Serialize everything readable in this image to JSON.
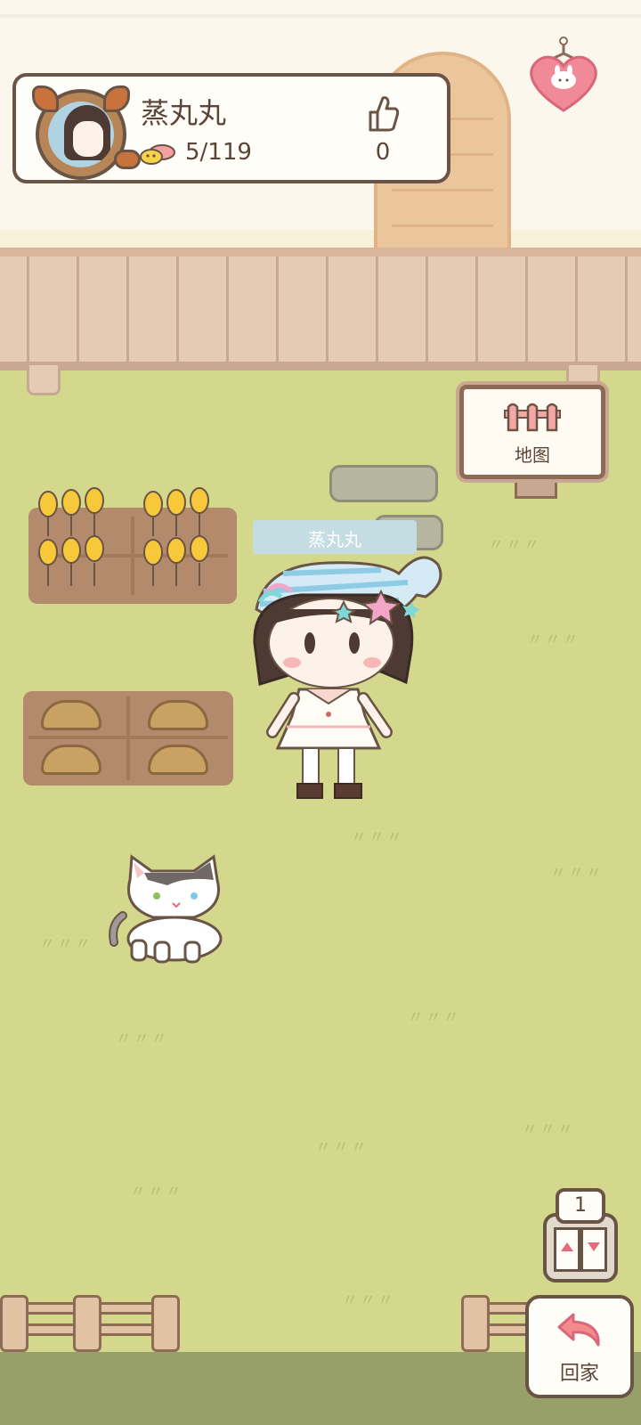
{
  "player": {
    "name": "蒸丸丸",
    "fish_count": "5/119",
    "like_count": "0"
  },
  "map_sign": {
    "label": "地图"
  },
  "character": {
    "name_tag": "蒸丸丸"
  },
  "elevator": {
    "floor": "1"
  },
  "home_button": {
    "label": "回家"
  },
  "icons": {
    "fish": "fish-icon",
    "thumb": "thumbs-up-icon",
    "heart": "heart-badge-icon",
    "map": "fence-map-icon",
    "home": "return-arrow-icon"
  },
  "colors": {
    "grass": "#D4D88C",
    "fence": "#E5CAB4",
    "outline": "#6A5446",
    "accent_pink": "#E56B7A",
    "name_ribbon": "#C4DDE2"
  }
}
